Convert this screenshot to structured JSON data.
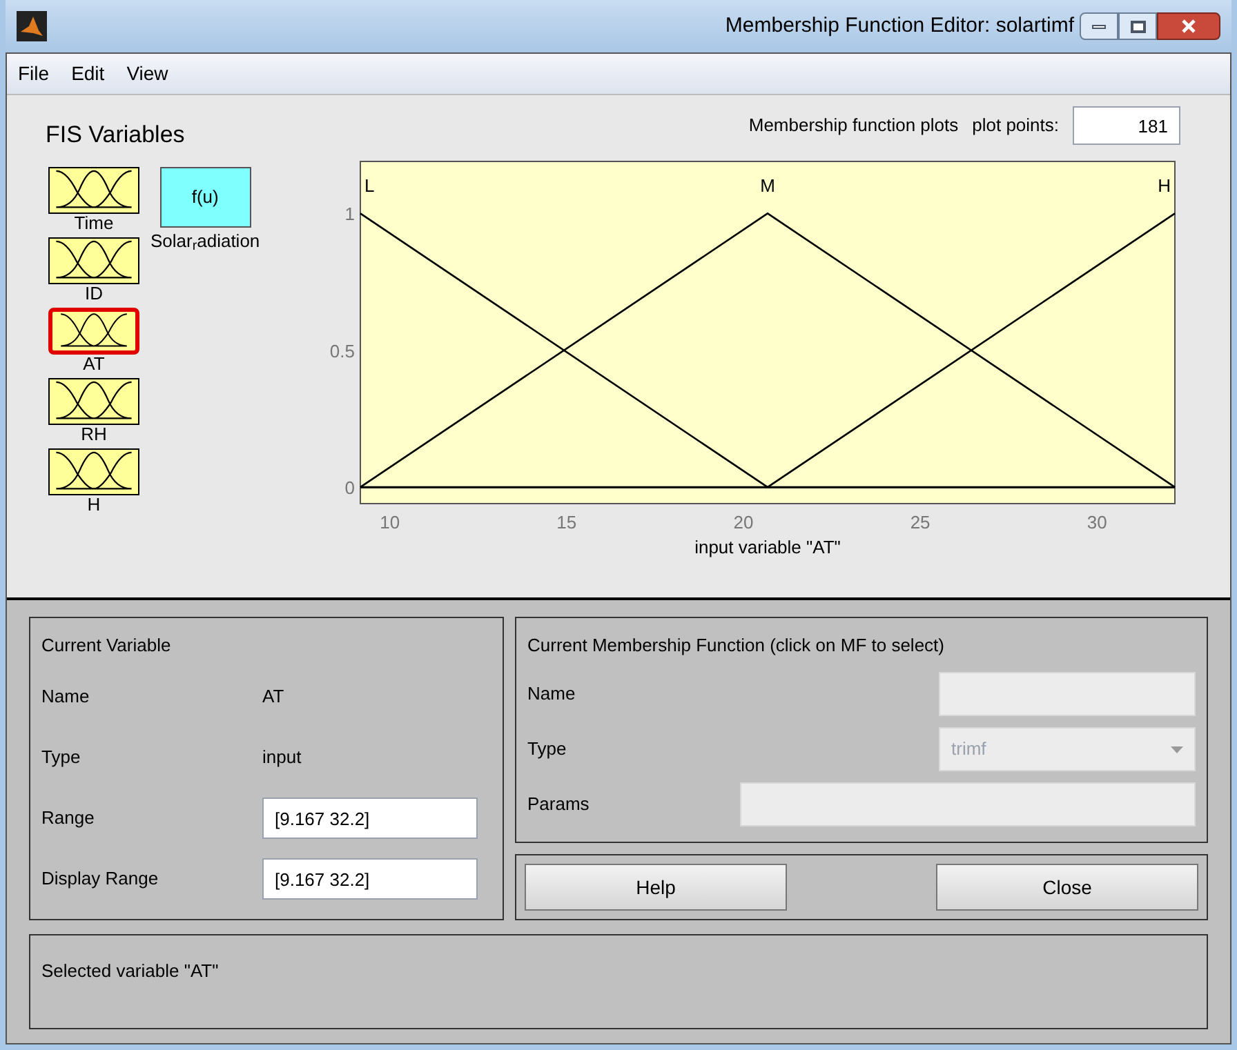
{
  "window": {
    "title": "Membership Function Editor: solartimf"
  },
  "menu": [
    "File",
    "Edit",
    "View"
  ],
  "fis_variables": {
    "title": "FIS Variables",
    "items": [
      {
        "name": "Time",
        "kind": "input",
        "selected": false
      },
      {
        "name": "Solar$_{r}$adiation",
        "kind": "output",
        "selected": false,
        "block_label": "f(u)"
      },
      {
        "name": "ID",
        "kind": "input",
        "selected": false
      },
      {
        "name": "AT",
        "kind": "input",
        "selected": true
      },
      {
        "name": "RH",
        "kind": "input",
        "selected": false
      },
      {
        "name": "H",
        "kind": "input",
        "selected": false
      }
    ]
  },
  "plot": {
    "title": "Membership function plots",
    "plot_points_label": "plot points:",
    "plot_points": "181",
    "chart_data": {
      "type": "line",
      "xlabel": "input variable \"AT\"",
      "x": [
        9.167,
        20.6835,
        32.2
      ],
      "series": [
        {
          "name": "L",
          "color": "#000000",
          "values": [
            1,
            0,
            0
          ]
        },
        {
          "name": "M",
          "color": "#000000",
          "values": [
            0,
            1,
            0
          ]
        },
        {
          "name": "H",
          "color": "#000000",
          "values": [
            0,
            0,
            1
          ]
        }
      ],
      "xlim": [
        9.167,
        32.2
      ],
      "ylim": [
        -0.06,
        1.19
      ],
      "xticks": [
        10,
        15,
        20,
        25,
        30
      ],
      "yticks": [
        0,
        0.5,
        1
      ]
    }
  },
  "current_variable": {
    "title": "Current Variable",
    "name_label": "Name",
    "name": "AT",
    "type_label": "Type",
    "type": "input",
    "range_label": "Range",
    "range": "[9.167 32.2]",
    "display_range_label": "Display Range",
    "display_range": "[9.167 32.2]"
  },
  "current_mf": {
    "title": "Current Membership Function (click on MF to select)",
    "name_label": "Name",
    "type_label": "Type",
    "type": "trimf",
    "params_label": "Params",
    "disabled": true
  },
  "buttons": [
    "Help",
    "Close"
  ],
  "status": "Selected variable \"AT\""
}
